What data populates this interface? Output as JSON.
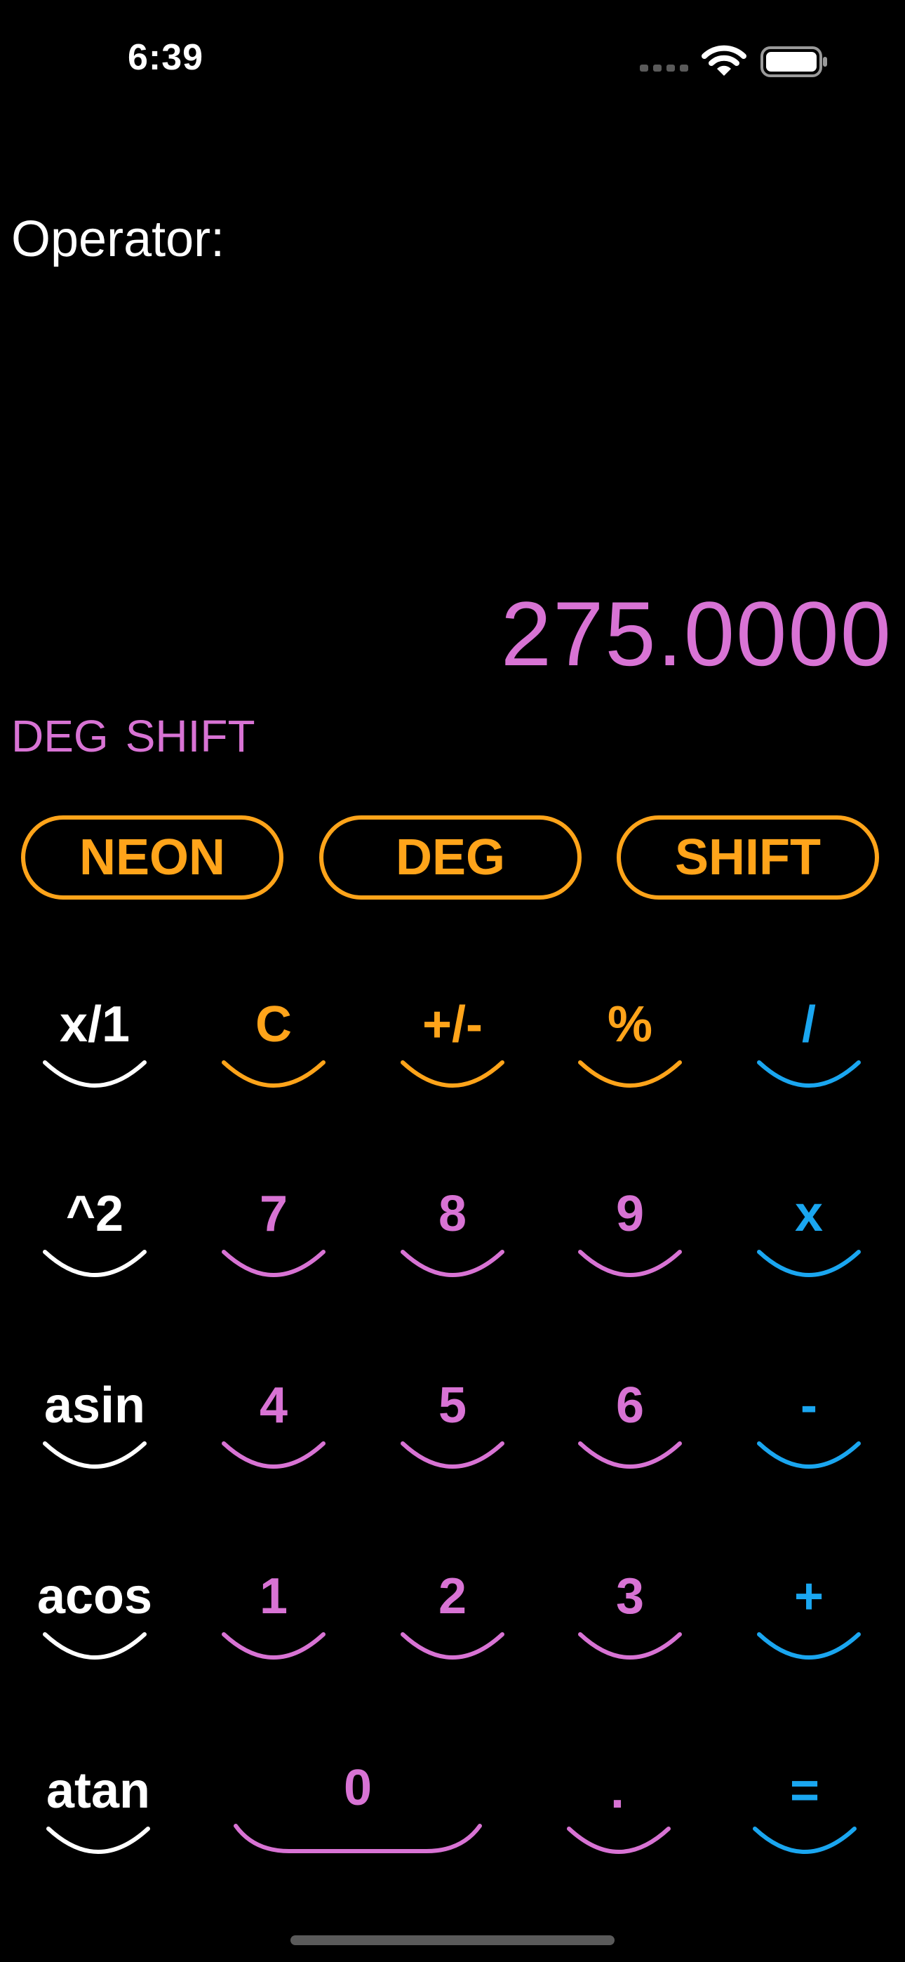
{
  "status_bar": {
    "time": "6:39",
    "signal_icon": "cellular-dots-icon",
    "wifi_icon": "wifi-icon",
    "battery_icon": "battery-icon"
  },
  "operator": {
    "label": "Operator:"
  },
  "display": {
    "value": "275.0000",
    "modes": [
      "DEG",
      "SHIFT"
    ]
  },
  "mode_buttons": {
    "neon": "NEON",
    "deg": "DEG",
    "shift": "SHIFT"
  },
  "keypad": {
    "row1": [
      "x/1",
      "C",
      "+/-",
      "%",
      "/"
    ],
    "row2": [
      "^2",
      "7",
      "8",
      "9",
      "x"
    ],
    "row3": [
      "asin",
      "4",
      "5",
      "6",
      "-"
    ],
    "row4": [
      "acos",
      "1",
      "2",
      "3",
      "+"
    ],
    "row5": [
      "atan",
      "0",
      ".",
      "="
    ]
  },
  "colors": {
    "background": "#000000",
    "orange": "#ffa41a",
    "violet": "#d873d4",
    "blue": "#1aa6f0",
    "white": "#ffffff"
  }
}
